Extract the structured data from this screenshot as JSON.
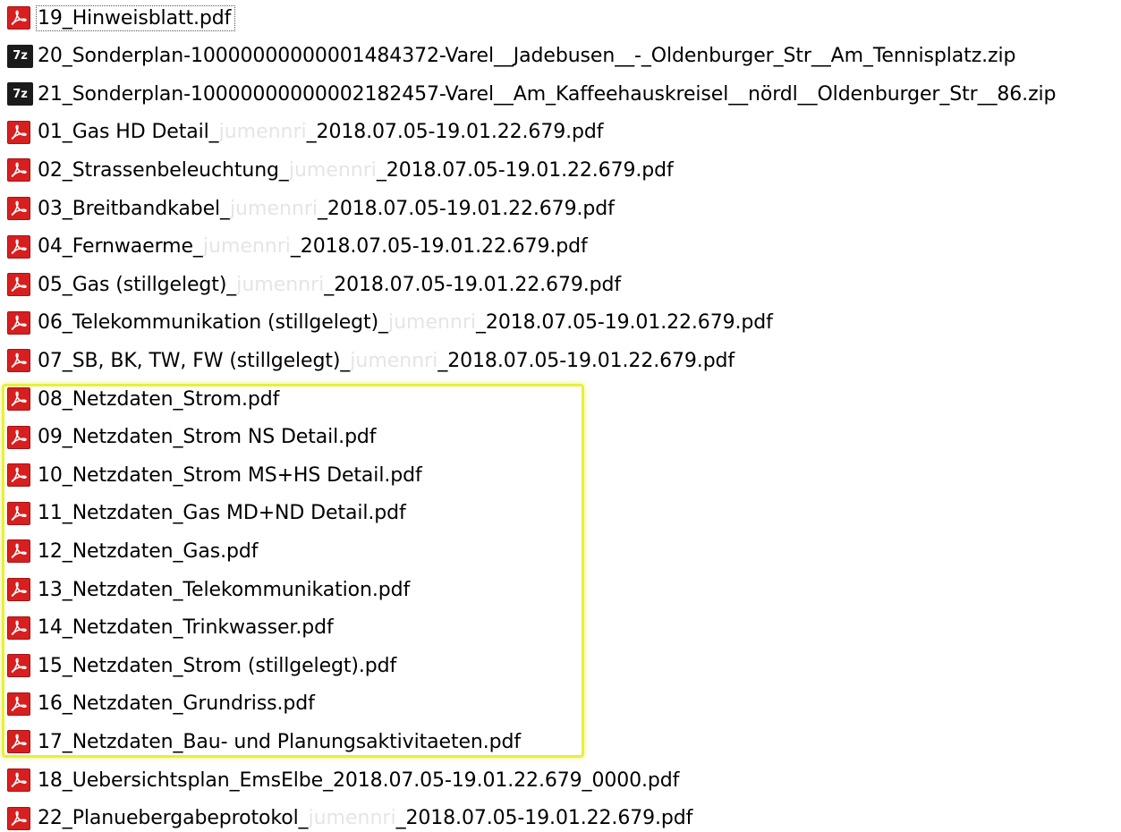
{
  "theme": {
    "pdf_icon_color": "#d71f1f",
    "zip_icon_color": "#1b1b1b",
    "highlight_color": "#e9ef38",
    "watermark_color": "#e5e5e5"
  },
  "files": [
    {
      "type": "pdf",
      "icon": "pdf-icon",
      "parts": [
        {
          "text": "19_Hinweisblatt.pdf"
        }
      ],
      "selected": true
    },
    {
      "type": "zip",
      "icon": "7zip-archive-icon",
      "icon_text": "7z",
      "parts": [
        {
          "text": "20_Sonderplan-10000000000001484372-Varel__Jadebusen__-_Oldenburger_Str__Am_Tennisplatz.zip"
        }
      ]
    },
    {
      "type": "zip",
      "icon": "7zip-archive-icon",
      "icon_text": "7z",
      "parts": [
        {
          "text": "21_Sonderplan-10000000000002182457-Varel__Am_Kaffeehauskreisel__nördl__Oldenburger_Str__86.zip"
        }
      ]
    },
    {
      "type": "pdf",
      "icon": "pdf-icon",
      "parts": [
        {
          "text": "01_Gas HD Detail_"
        },
        {
          "text": "jumennri",
          "watermark": true
        },
        {
          "text": "_2018.07.05-19.01.22.679.pdf"
        }
      ]
    },
    {
      "type": "pdf",
      "icon": "pdf-icon",
      "parts": [
        {
          "text": "02_Strassenbeleuchtung_"
        },
        {
          "text": "jumennri",
          "watermark": true
        },
        {
          "text": "_2018.07.05-19.01.22.679.pdf"
        }
      ]
    },
    {
      "type": "pdf",
      "icon": "pdf-icon",
      "parts": [
        {
          "text": "03_Breitbandkabel_"
        },
        {
          "text": "jumennri",
          "watermark": true
        },
        {
          "text": "_2018.07.05-19.01.22.679.pdf"
        }
      ]
    },
    {
      "type": "pdf",
      "icon": "pdf-icon",
      "parts": [
        {
          "text": "04_Fernwaerme_"
        },
        {
          "text": "jumennri",
          "watermark": true
        },
        {
          "text": "_2018.07.05-19.01.22.679.pdf"
        }
      ]
    },
    {
      "type": "pdf",
      "icon": "pdf-icon",
      "parts": [
        {
          "text": "05_Gas (stillgelegt)_"
        },
        {
          "text": "jumennri",
          "watermark": true
        },
        {
          "text": "_2018.07.05-19.01.22.679.pdf"
        }
      ]
    },
    {
      "type": "pdf",
      "icon": "pdf-icon",
      "parts": [
        {
          "text": "06_Telekommunikation (stillgelegt)_"
        },
        {
          "text": "jumennri",
          "watermark": true
        },
        {
          "text": "_2018.07.05-19.01.22.679.pdf"
        }
      ]
    },
    {
      "type": "pdf",
      "icon": "pdf-icon",
      "parts": [
        {
          "text": "07_SB, BK, TW, FW (stillgelegt)_"
        },
        {
          "text": "jumennri",
          "watermark": true
        },
        {
          "text": "_2018.07.05-19.01.22.679.pdf"
        }
      ]
    },
    {
      "type": "pdf",
      "icon": "pdf-icon",
      "parts": [
        {
          "text": "08_Netzdaten_Strom.pdf"
        }
      ]
    },
    {
      "type": "pdf",
      "icon": "pdf-icon",
      "parts": [
        {
          "text": "09_Netzdaten_Strom NS Detail.pdf"
        }
      ]
    },
    {
      "type": "pdf",
      "icon": "pdf-icon",
      "parts": [
        {
          "text": "10_Netzdaten_Strom MS+HS Detail.pdf"
        }
      ]
    },
    {
      "type": "pdf",
      "icon": "pdf-icon",
      "parts": [
        {
          "text": "11_Netzdaten_Gas MD+ND Detail.pdf"
        }
      ]
    },
    {
      "type": "pdf",
      "icon": "pdf-icon",
      "parts": [
        {
          "text": "12_Netzdaten_Gas.pdf"
        }
      ]
    },
    {
      "type": "pdf",
      "icon": "pdf-icon",
      "parts": [
        {
          "text": "13_Netzdaten_Telekommunikation.pdf"
        }
      ]
    },
    {
      "type": "pdf",
      "icon": "pdf-icon",
      "parts": [
        {
          "text": "14_Netzdaten_Trinkwasser.pdf"
        }
      ]
    },
    {
      "type": "pdf",
      "icon": "pdf-icon",
      "parts": [
        {
          "text": "15_Netzdaten_Strom (stillgelegt).pdf"
        }
      ]
    },
    {
      "type": "pdf",
      "icon": "pdf-icon",
      "parts": [
        {
          "text": "16_Netzdaten_Grundriss.pdf"
        }
      ]
    },
    {
      "type": "pdf",
      "icon": "pdf-icon",
      "parts": [
        {
          "text": "17_Netzdaten_Bau- und Planungsaktivitaeten.pdf"
        }
      ]
    },
    {
      "type": "pdf",
      "icon": "pdf-icon",
      "parts": [
        {
          "text": "18_Uebersichtsplan_EmsElbe_2018.07.05-19.01.22.679_0000.pdf"
        }
      ]
    },
    {
      "type": "pdf",
      "icon": "pdf-icon",
      "parts": [
        {
          "text": "22_Planuebergabeprotokol_"
        },
        {
          "text": "jumennri",
          "watermark": true
        },
        {
          "text": "_2018.07.05-19.01.22.679.pdf"
        }
      ]
    }
  ]
}
